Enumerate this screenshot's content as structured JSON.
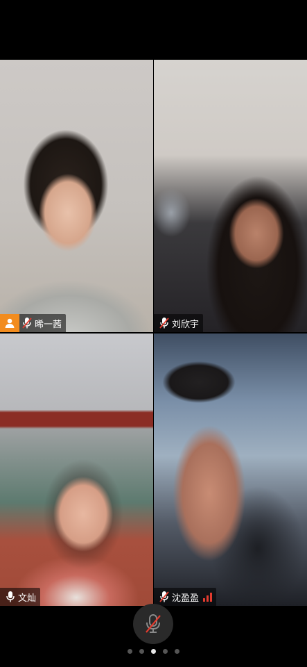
{
  "participants": [
    {
      "name": "晞一茜",
      "is_host": true,
      "mic": "muted",
      "signal": false
    },
    {
      "name": "刘欣宇",
      "is_host": false,
      "mic": "muted",
      "signal": false
    },
    {
      "name": "文灿",
      "is_host": false,
      "mic": "on",
      "signal": false
    },
    {
      "name": "沈盈盈",
      "is_host": false,
      "mic": "muted",
      "signal": true,
      "signal_color": "#e33b2e"
    }
  ],
  "controls": {
    "mic_button_state": "muted",
    "page_count": 5,
    "active_page": 3
  },
  "colors": {
    "host_badge": "#f28c1e",
    "mute_slash": "#e33b2e"
  },
  "icons": [
    "person-icon",
    "mic-muted-icon",
    "mic-icon",
    "signal-icon"
  ]
}
